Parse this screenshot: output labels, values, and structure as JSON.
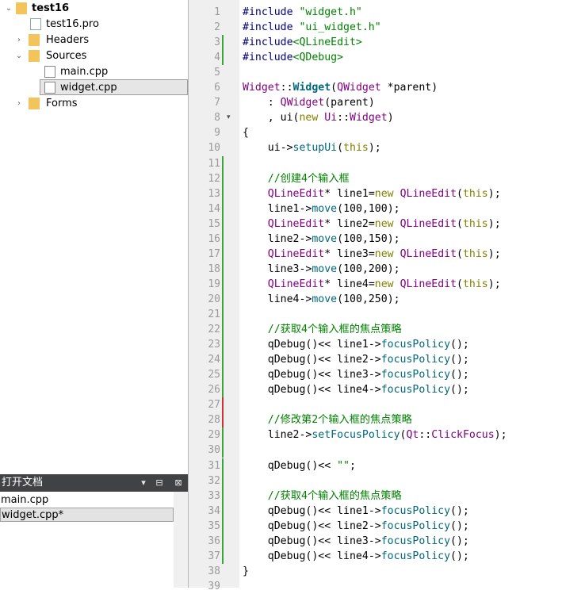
{
  "project_tree": {
    "project": "test16",
    "pro_file": "test16.pro",
    "headers": "Headers",
    "sources": "Sources",
    "main_cpp": "main.cpp",
    "widget_cpp": "widget.cpp",
    "forms": "Forms"
  },
  "open_documents": {
    "title": "打开文档",
    "items": [
      "main.cpp",
      "widget.cpp*"
    ]
  },
  "editor": {
    "lines": [
      "#include \"widget.h\"",
      "#include \"ui_widget.h\"",
      "#include<QLineEdit>",
      "#include<QDebug>",
      "",
      "Widget::Widget(QWidget *parent)",
      "    : QWidget(parent)",
      "    , ui(new Ui::Widget)",
      "{",
      "    ui->setupUi(this);",
      "",
      "    //创建4个输入框",
      "    QLineEdit* line1=new QLineEdit(this);",
      "    line1->move(100,100);",
      "    QLineEdit* line2=new QLineEdit(this);",
      "    line2->move(100,150);",
      "    QLineEdit* line3=new QLineEdit(this);",
      "    line3->move(100,200);",
      "    QLineEdit* line4=new QLineEdit(this);",
      "    line4->move(100,250);",
      "",
      "    //获取4个输入框的焦点策略",
      "    qDebug()<< line1->focusPolicy();",
      "    qDebug()<< line2->focusPolicy();",
      "    qDebug()<< line3->focusPolicy();",
      "    qDebug()<< line4->focusPolicy();",
      "",
      "    //修改第2个输入框的焦点策略",
      "    line2->setFocusPolicy(Qt::ClickFocus);",
      "",
      "    qDebug()<< \"\";",
      "",
      "    //获取4个输入框的焦点策略",
      "    qDebug()<< line1->focusPolicy();",
      "    qDebug()<< line2->focusPolicy();",
      "    qDebug()<< line3->focusPolicy();",
      "    qDebug()<< line4->focusPolicy();",
      "}",
      ""
    ],
    "line_numbers": [
      "1",
      "2",
      "3",
      "4",
      "5",
      "6",
      "7",
      "8",
      "9",
      "10",
      "11",
      "12",
      "13",
      "14",
      "15",
      "16",
      "17",
      "18",
      "19",
      "20",
      "21",
      "22",
      "23",
      "24",
      "25",
      "26",
      "27",
      "28",
      "29",
      "30",
      "31",
      "32",
      "33",
      "34",
      "35",
      "36",
      "37",
      "38",
      "39"
    ],
    "change_markers": {
      "added_color": "#3aa53a",
      "modified_color": "#d03030"
    }
  },
  "colors": {
    "keyword": "#808000",
    "string": "#008000",
    "class": "#800080",
    "function": "#00677c",
    "comment": "#008000",
    "panel_header": "#404244"
  }
}
